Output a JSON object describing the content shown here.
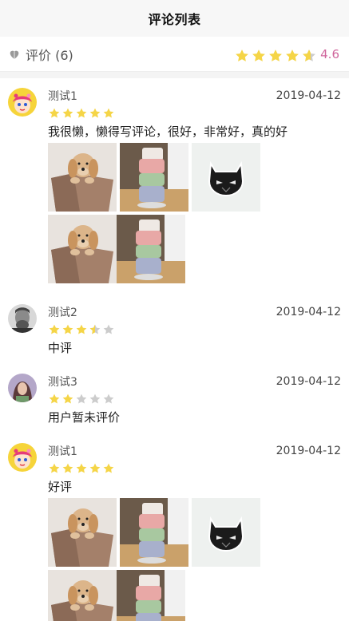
{
  "header": {
    "title": "评论列表"
  },
  "summary": {
    "label": "评价 (6)",
    "rating": 4.6,
    "score_text": "4.6",
    "star_color": "#f5d547",
    "score_color": "#d0679d"
  },
  "reviews": [
    {
      "user": "测试1",
      "date": "2019-04-12",
      "rating": 5,
      "avatar": "girl-avatar",
      "content": "我很懒，懒得写评论，很好，非常好，真的好",
      "photos": [
        "dog-in-bag-photo",
        "stackable-storage-photo",
        "black-cat-sticker-photo",
        "dog-in-bag-photo",
        "stackable-storage-photo"
      ]
    },
    {
      "user": "测试2",
      "date": "2019-04-12",
      "rating": 3.5,
      "avatar": "old-man-avatar",
      "content": "中评",
      "photos": []
    },
    {
      "user": "测试3",
      "date": "2019-04-12",
      "rating": 2,
      "avatar": "woman-avatar",
      "content": "用户暂未评价",
      "photos": []
    },
    {
      "user": "测试1",
      "date": "2019-04-12",
      "rating": 5,
      "avatar": "girl-avatar",
      "content": "好评",
      "photos": [
        "dog-in-bag-photo",
        "stackable-storage-photo",
        "black-cat-sticker-photo",
        "dog-in-bag-photo",
        "stackable-storage-photo"
      ]
    }
  ]
}
